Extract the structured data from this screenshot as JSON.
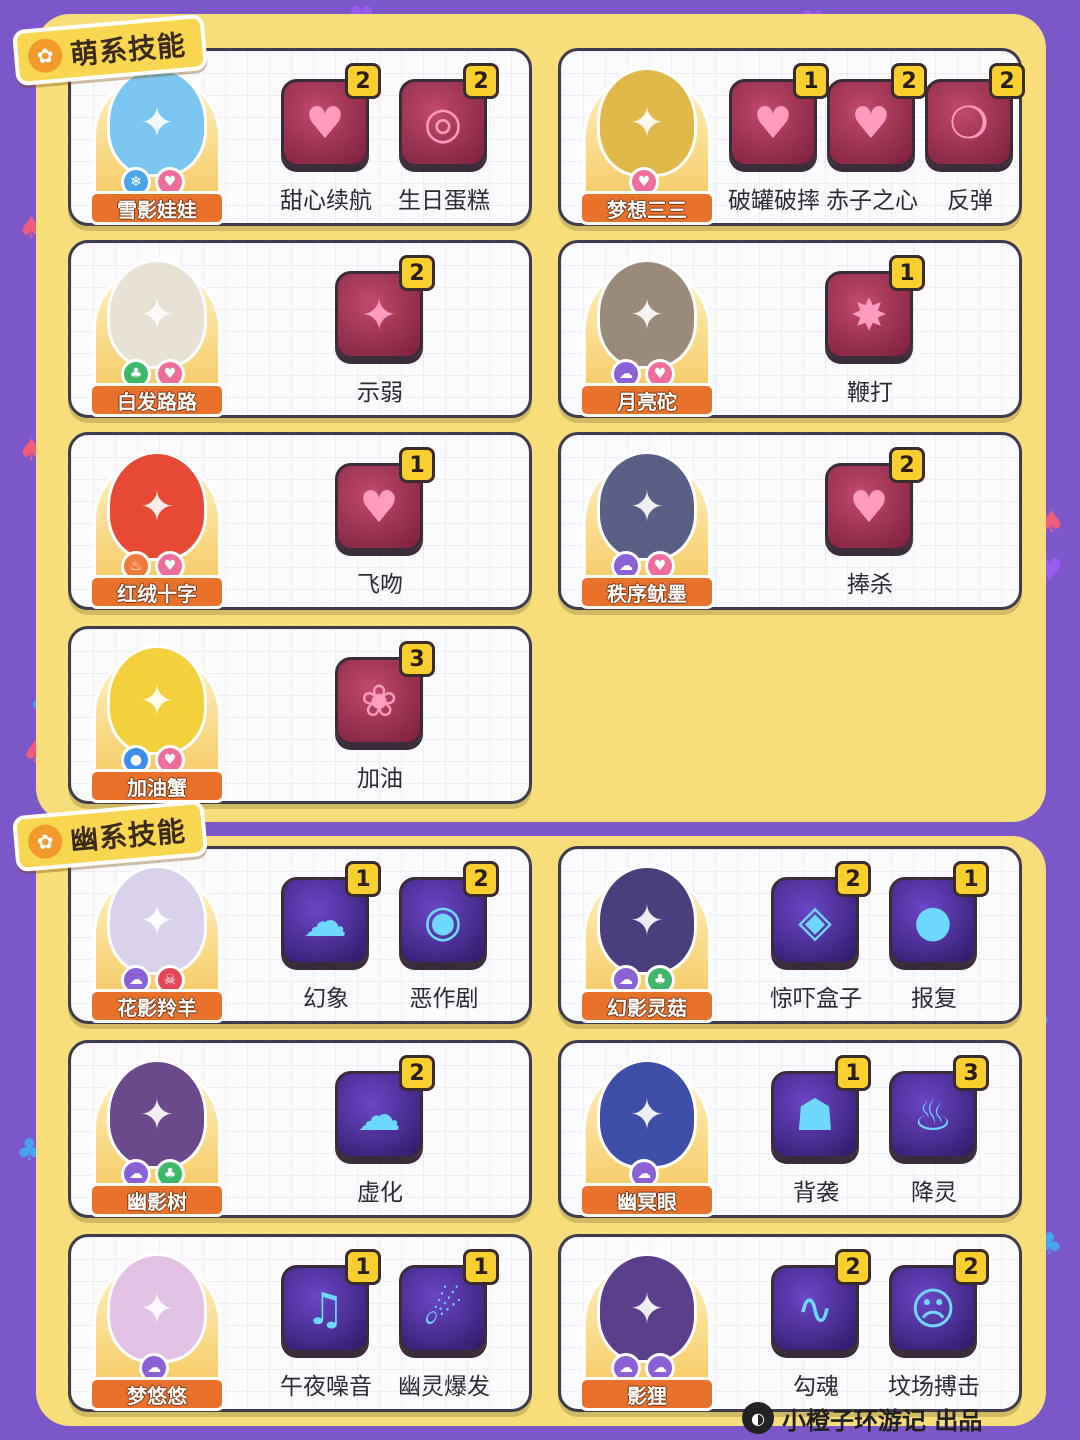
{
  "sections": [
    {
      "title": "萌系技能",
      "kind": "cute",
      "cards": [
        {
          "name": "雪影娃娃",
          "attrs": [
            "snow-icon",
            "heart-icon"
          ],
          "colors": [
            "#4aa6e8",
            "#ef6e9c"
          ],
          "body": "#7cc6f2",
          "skills": [
            {
              "label": "甜心续航",
              "count": "2",
              "icon": "♥"
            },
            {
              "label": "生日蛋糕",
              "count": "2",
              "icon": "◎"
            }
          ]
        },
        {
          "name": "梦想三三",
          "attrs": [
            "heart-icon"
          ],
          "colors": [
            "#ef6e9c"
          ],
          "body": "#e0b94a",
          "skills": [
            {
              "label": "破罐破摔",
              "count": "1",
              "icon": "♥"
            },
            {
              "label": "赤子之心",
              "count": "2",
              "icon": "♥"
            },
            {
              "label": "反弹",
              "count": "2",
              "icon": "❍"
            }
          ]
        },
        {
          "name": "白发路路",
          "attrs": [
            "leaf-icon",
            "heart-icon"
          ],
          "colors": [
            "#3fb86b",
            "#ef6e9c"
          ],
          "body": "#e8e2d6",
          "skills": [
            {
              "label": "示弱",
              "count": "2",
              "icon": "✦"
            }
          ]
        },
        {
          "name": "月亮砣",
          "attrs": [
            "ghost-icon",
            "heart-icon"
          ],
          "colors": [
            "#8a62d6",
            "#ef6e9c"
          ],
          "body": "#9a8a7a",
          "skills": [
            {
              "label": "鞭打",
              "count": "1",
              "icon": "✸"
            }
          ]
        },
        {
          "name": "红绒十字",
          "attrs": [
            "fire-icon",
            "heart-icon"
          ],
          "colors": [
            "#f07a3a",
            "#ef6e9c"
          ],
          "body": "#e64a36",
          "skills": [
            {
              "label": "飞吻",
              "count": "1",
              "icon": "♥"
            }
          ]
        },
        {
          "name": "秩序鱿墨",
          "attrs": [
            "ghost-icon",
            "heart-icon"
          ],
          "colors": [
            "#8a62d6",
            "#ef6e9c"
          ],
          "body": "#5a5f86",
          "skills": [
            {
              "label": "捧杀",
              "count": "2",
              "icon": "♥"
            }
          ]
        },
        {
          "name": "加油蟹",
          "attrs": [
            "water-icon",
            "heart-icon"
          ],
          "colors": [
            "#3d8ee8",
            "#ef6e9c"
          ],
          "body": "#f2d03c",
          "skills": [
            {
              "label": "加油",
              "count": "3",
              "icon": "❀"
            }
          ]
        }
      ]
    },
    {
      "title": "幽系技能",
      "kind": "ghost",
      "cards": [
        {
          "name": "花影羚羊",
          "attrs": [
            "ghost-icon",
            "demon-icon"
          ],
          "colors": [
            "#8a62d6",
            "#e4475a"
          ],
          "body": "#d9d2ea",
          "skills": [
            {
              "label": "幻象",
              "count": "1",
              "icon": "☁"
            },
            {
              "label": "恶作剧",
              "count": "2",
              "icon": "◉"
            }
          ]
        },
        {
          "name": "幻影灵菇",
          "attrs": [
            "ghost-icon",
            "leaf-icon"
          ],
          "colors": [
            "#8a62d6",
            "#3fb86b"
          ],
          "body": "#4a3f7c",
          "skills": [
            {
              "label": "惊吓盒子",
              "count": "2",
              "icon": "◈"
            },
            {
              "label": "报复",
              "count": "1",
              "icon": "●"
            }
          ]
        },
        {
          "name": "幽影树",
          "attrs": [
            "ghost-icon",
            "leaf-icon"
          ],
          "colors": [
            "#8a62d6",
            "#3fb86b"
          ],
          "body": "#6a4a8a",
          "skills": [
            {
              "label": "虚化",
              "count": "2",
              "icon": "☁"
            }
          ]
        },
        {
          "name": "幽冥眼",
          "attrs": [
            "ghost-icon"
          ],
          "colors": [
            "#8a62d6"
          ],
          "body": "#3f4ea6",
          "skills": [
            {
              "label": "背袭",
              "count": "1",
              "icon": "☗"
            },
            {
              "label": "降灵",
              "count": "3",
              "icon": "♨"
            }
          ]
        },
        {
          "name": "梦悠悠",
          "attrs": [
            "ghost-icon"
          ],
          "colors": [
            "#8a62d6"
          ],
          "body": "#e2c2e4",
          "skills": [
            {
              "label": "午夜噪音",
              "count": "1",
              "icon": "♫"
            },
            {
              "label": "幽灵爆发",
              "count": "1",
              "icon": "☄"
            }
          ]
        },
        {
          "name": "影狸",
          "attrs": [
            "ghost-icon",
            "ghost-icon"
          ],
          "colors": [
            "#8a62d6",
            "#8a62d6"
          ],
          "body": "#5a3f8a",
          "skills": [
            {
              "label": "勾魂",
              "count": "2",
              "icon": "∿"
            },
            {
              "label": "坟场搏击",
              "count": "2",
              "icon": "☹"
            }
          ]
        }
      ]
    }
  ],
  "footer": {
    "text": "小橙子环游记 出品",
    "logo": "planet-icon"
  }
}
